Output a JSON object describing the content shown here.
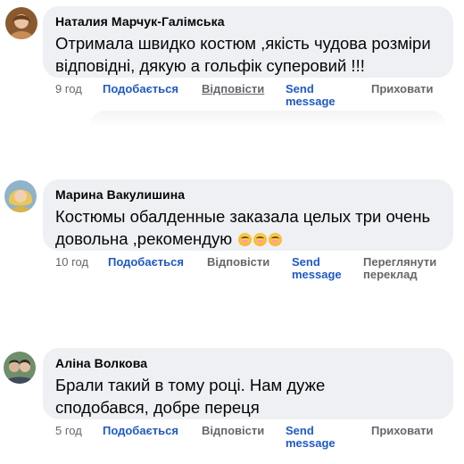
{
  "comments": [
    {
      "author": "Наталия Марчук-Галімська",
      "text": "Отримала швидко костюм ,якість чудова розміри відповідні, дякую а гольфік суперовий !!!",
      "time": "9 год",
      "like_label": "Подобається",
      "reply_label": "Відповісти",
      "send_message_label": "Send message",
      "extra_label": "Приховати",
      "avatar_icon": "user-avatar-icon"
    },
    {
      "author": "Марина Вакулишина",
      "text": "Костюмы обалденные заказала целых три очень довольна ,рекомендую",
      "emoji_count": 3,
      "time": "10 год",
      "like_label": "Подобається",
      "reply_label": "Відповісти",
      "send_message_label": "Send message",
      "extra_label": "Переглянути переклад",
      "avatar_icon": "user-avatar-icon"
    },
    {
      "author": "Аліна Волкова",
      "text": "Брали такий в тому році. Нам дуже сподобався, добре переця",
      "time": "5 год",
      "like_label": "Подобається",
      "reply_label": "Відповісти",
      "send_message_label": "Send message",
      "extra_label": "Приховати",
      "avatar_icon": "user-avatar-icon"
    }
  ],
  "colors": {
    "bubble": "#eef0f4",
    "link_blue": "#1f59c6",
    "meta_gray": "#65676b"
  }
}
